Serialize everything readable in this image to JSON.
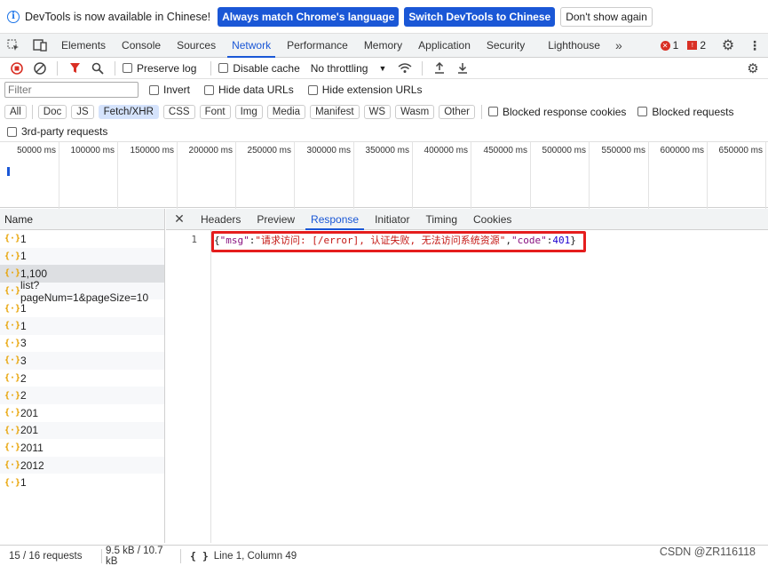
{
  "infobar": {
    "message": "DevTools is now available in Chinese!",
    "btn_match": "Always match Chrome's language",
    "btn_switch": "Switch DevTools to Chinese",
    "btn_dismiss": "Don't show again"
  },
  "tabs": [
    "Elements",
    "Console",
    "Sources",
    "Network",
    "Performance",
    "Memory",
    "Application",
    "Security",
    "Lighthouse"
  ],
  "active_tab": "Network",
  "error_count": "1",
  "issue_count": "2",
  "toolbar": {
    "preserve_log": "Preserve log",
    "disable_cache": "Disable cache",
    "throttling": "No throttling"
  },
  "filter": {
    "placeholder": "Filter",
    "invert": "Invert",
    "hide_data_urls": "Hide data URLs",
    "hide_extension_urls": "Hide extension URLs"
  },
  "type_chips": [
    "All",
    "Doc",
    "JS",
    "Fetch/XHR",
    "CSS",
    "Font",
    "Img",
    "Media",
    "Manifest",
    "WS",
    "Wasm",
    "Other"
  ],
  "active_chip": "Fetch/XHR",
  "blocked_response_cookies": "Blocked response cookies",
  "blocked_requests": "Blocked requests",
  "third_party": "3rd-party requests",
  "timeline_ticks": [
    "50000 ms",
    "100000 ms",
    "150000 ms",
    "200000 ms",
    "250000 ms",
    "300000 ms",
    "350000 ms",
    "400000 ms",
    "450000 ms",
    "500000 ms",
    "550000 ms",
    "600000 ms",
    "650000 ms"
  ],
  "list": {
    "header": "Name",
    "items": [
      "1",
      "1",
      "1,100",
      "list?pageNum=1&pageSize=10",
      "1",
      "1",
      "3",
      "3",
      "2",
      "2",
      "201",
      "201",
      "2011",
      "2012",
      "1"
    ],
    "selected_index": 2
  },
  "detail": {
    "tabs": [
      "Headers",
      "Preview",
      "Response",
      "Initiator",
      "Timing",
      "Cookies"
    ],
    "active": "Response",
    "line_number": "1",
    "response": {
      "open": "{",
      "key1": "\"msg\"",
      "colon1": ":",
      "val1": "\"请求访问: [/error], 认证失败, 无法访问系统资源\"",
      "comma": ",",
      "key2": "\"code\"",
      "colon2": ":",
      "val2": "401",
      "close": "}"
    }
  },
  "status": {
    "requests": "15 / 16 requests",
    "size": "9.5 kB / 10.7 kB",
    "position": "Line 1, Column 49"
  },
  "watermark": "CSDN @ZR116118"
}
